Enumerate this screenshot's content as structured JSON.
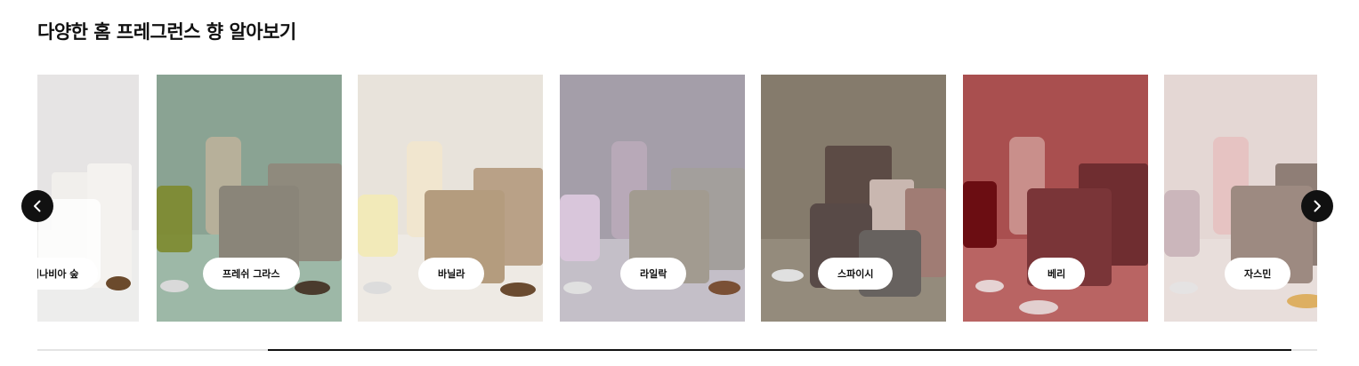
{
  "section": {
    "title": "다양한 홈 프레그런스 향 알아보기"
  },
  "carousel": {
    "prev_icon": "chevron-left-icon",
    "next_icon": "chevron-right-icon",
    "items": [
      {
        "label": "니나비아 숲",
        "bg": "#e6e4e4",
        "floor": "#ededec",
        "accent": "#dcd7d2"
      },
      {
        "label": "프레쉬 그라스",
        "bg": "#8aa393",
        "floor": "#9db8a7",
        "accent": "#b7b09a"
      },
      {
        "label": "바닐라",
        "bg": "#e8e3db",
        "floor": "#eeeae4",
        "accent": "#f1e6cf"
      },
      {
        "label": "라일락",
        "bg": "#a49ea9",
        "floor": "#c4bfc8",
        "accent": "#b8a9b8"
      },
      {
        "label": "스파이시",
        "bg": "#857b6c",
        "floor": "#948b7c",
        "accent": "#c9b7b0"
      },
      {
        "label": "베리",
        "bg": "#a94f4f",
        "floor": "#b96463",
        "accent": "#c98f8b"
      },
      {
        "label": "자스민",
        "bg": "#e4d7d4",
        "floor": "#e8dedb",
        "accent": "#e6c3c2"
      }
    ]
  },
  "progress": {
    "position_fraction": 0.18,
    "visible_fraction": 0.8
  },
  "colors": {
    "accent": "#111111",
    "track": "#e4e4e4"
  }
}
